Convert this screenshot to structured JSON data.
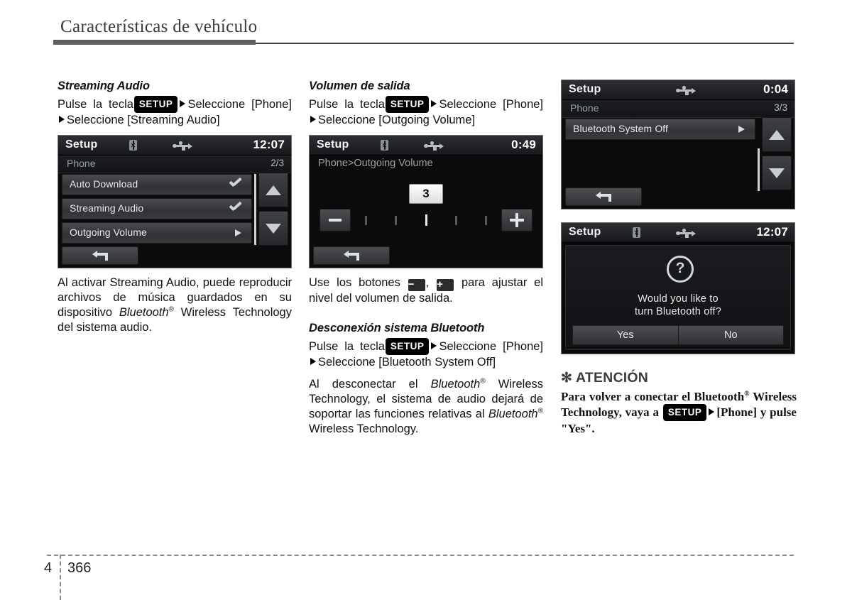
{
  "page": {
    "header_title": "Características de vehículo",
    "chapter": "4",
    "number": "366"
  },
  "column_one": {
    "section_title": "Streaming Audio",
    "path_prefix": "Pulse la tecla",
    "setup_badge": "SETUP",
    "path_mid": "Seleccione [Phone]",
    "path_end": "Seleccione [Streaming Audio]",
    "screen": {
      "title": "Setup",
      "clock": "12:07",
      "bt_icon": "bluetooth-icon",
      "usb_icon": "usb-icon",
      "breadcrumb": "Phone",
      "page_count": "2/3",
      "rows": [
        {
          "label": "Auto Download",
          "indicator": "check"
        },
        {
          "label": "Streaming Audio",
          "indicator": "check"
        },
        {
          "label": "Outgoing Volume",
          "indicator": "arrow"
        }
      ],
      "scroll_up": "scroll-up-arrow",
      "scroll_down": "scroll-down-arrow",
      "back": "back-icon"
    },
    "body_text": "Al activar Streaming Audio, puede reproducir archivos de música guardados en su dispositivo Bluetooth® Wireless Technology del sistema audio."
  },
  "column_two": {
    "section_title": "Volumen de salida",
    "path_prefix": "Pulse la tecla",
    "setup_badge": "SETUP",
    "path_mid": "Seleccione [Phone]",
    "path_end": "Seleccione [Outgoing Volume]",
    "screen": {
      "title": "Setup",
      "clock": "0:49",
      "breadcrumb": "Phone>Outgoing Volume",
      "value": "3",
      "minus_label": "−",
      "plus_label": "+",
      "ticks": 5,
      "active_tick": 3,
      "back": "back-icon"
    },
    "usage_text_a": "Use los botones",
    "usage_chip_minus": "−",
    "usage_chip_plus": "+",
    "usage_text_b": "para ajustar el nivel del volumen de salida.",
    "section2_title": "Desconexión sistema Bluetooth",
    "path2_prefix": "Pulse la tecla",
    "path2_mid": "Seleccione [Phone]",
    "path2_end": "Seleccione [Bluetooth System Off]",
    "body_text": "Al desconectar el Bluetooth® Wireless Technology, el sistema de audio dejará de soportar las funciones relativas al Bluetooth® Wireless Technology."
  },
  "column_three": {
    "screen_top": {
      "title": "Setup",
      "clock": "0:04",
      "usb_icon": "usb-icon",
      "breadcrumb": "Phone",
      "page_count": "3/3",
      "rows": [
        {
          "label": "Bluetooth System Off",
          "indicator": "arrow"
        }
      ],
      "scroll_up": "scroll-up-arrow",
      "scroll_down": "scroll-down-arrow",
      "back": "back-icon"
    },
    "screen_dialog": {
      "title": "Setup",
      "clock": "12:07",
      "bt_icon": "bluetooth-icon",
      "usb_icon": "usb-icon",
      "question_icon": "question-mark-icon",
      "message_line1": "Would you like to",
      "message_line2": "turn Bluetooth off?",
      "yes_label": "Yes",
      "no_label": "No"
    },
    "notice": {
      "star": "✻",
      "title": "ATENCIÓN",
      "text_a": "Para volver a conectar el Bluetooth® Wireless Technology, vaya a",
      "setup_badge": "SETUP",
      "text_b": "[Phone] y pulse \"Yes\"."
    }
  }
}
